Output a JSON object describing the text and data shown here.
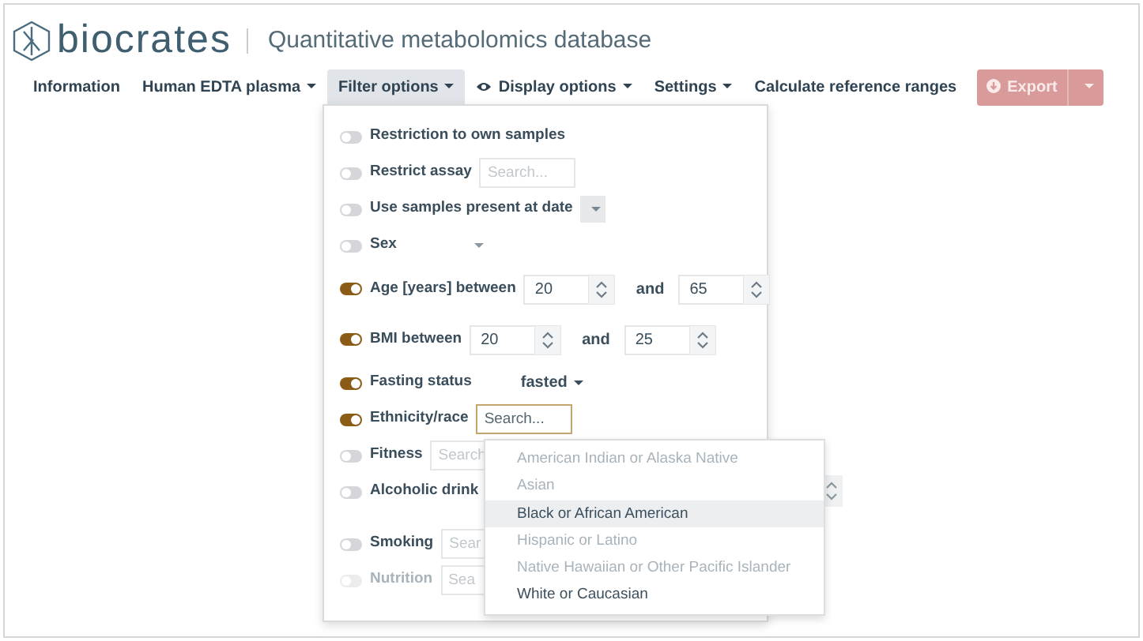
{
  "header": {
    "brand": "biocrates",
    "subtitle": "Quantitative metabolomics database"
  },
  "nav": [
    {
      "label": "Information",
      "kind": "link",
      "selected": false
    },
    {
      "label": "Human EDTA plasma",
      "kind": "menu",
      "selected": false
    },
    {
      "label": "Filter options",
      "kind": "menu",
      "selected": true
    },
    {
      "label": "Display options",
      "kind": "eye-menu",
      "selected": false
    },
    {
      "label": "Settings",
      "kind": "menu",
      "selected": false
    },
    {
      "label": "Calculate reference ranges",
      "kind": "link",
      "selected": false
    },
    {
      "label": "Export",
      "kind": "export",
      "selected": false
    }
  ],
  "filters": [
    {
      "kind": "plain",
      "label": "Restriction to own samples",
      "on": false,
      "disabled": false
    },
    {
      "kind": "search",
      "label": "Restrict assay",
      "on": false,
      "disabled": false,
      "placeholder": "Search...",
      "focused": false
    },
    {
      "kind": "select",
      "label": "Use samples present at date",
      "on": false,
      "disabled": false
    },
    {
      "kind": "choice",
      "label": "Sex",
      "on": false,
      "disabled": false
    },
    {
      "kind": "range",
      "label": "Age [years] between",
      "on": true,
      "disabled": false,
      "from": "20",
      "joiner": "and",
      "to": "65"
    },
    {
      "kind": "range",
      "label": "BMI between",
      "on": true,
      "disabled": false,
      "from": "20",
      "joiner": "and",
      "to": "25"
    },
    {
      "kind": "choice",
      "label": "Fasting status",
      "on": true,
      "disabled": false,
      "value": "fasted"
    },
    {
      "kind": "search",
      "label": "Ethnicity/race",
      "on": true,
      "disabled": false,
      "placeholder": "Search...",
      "focused": true
    },
    {
      "kind": "search",
      "label": "Fitness",
      "on": false,
      "disabled": false,
      "placeholder": "Search",
      "focused": false
    },
    {
      "kind": "spin",
      "label": "Alcoholic drink",
      "on": false,
      "disabled": false
    },
    {
      "kind": "search",
      "label": "Smoking",
      "on": false,
      "disabled": false,
      "placeholder": "Sear",
      "focused": false
    },
    {
      "kind": "search",
      "label": "Nutrition",
      "on": false,
      "disabled": true,
      "placeholder": "Sea",
      "focused": false
    }
  ],
  "ethnicity_options": [
    {
      "label": "American Indian or Alaska Native",
      "disabled": true,
      "selected": false
    },
    {
      "label": "Asian",
      "disabled": true,
      "selected": false
    },
    {
      "label": "Black or African American",
      "disabled": false,
      "selected": true
    },
    {
      "label": "Hispanic or Latino",
      "disabled": true,
      "selected": false
    },
    {
      "label": "Native Hawaiian or Other Pacific Islander",
      "disabled": true,
      "selected": false
    },
    {
      "label": "White or Caucasian",
      "disabled": false,
      "selected": false
    }
  ]
}
